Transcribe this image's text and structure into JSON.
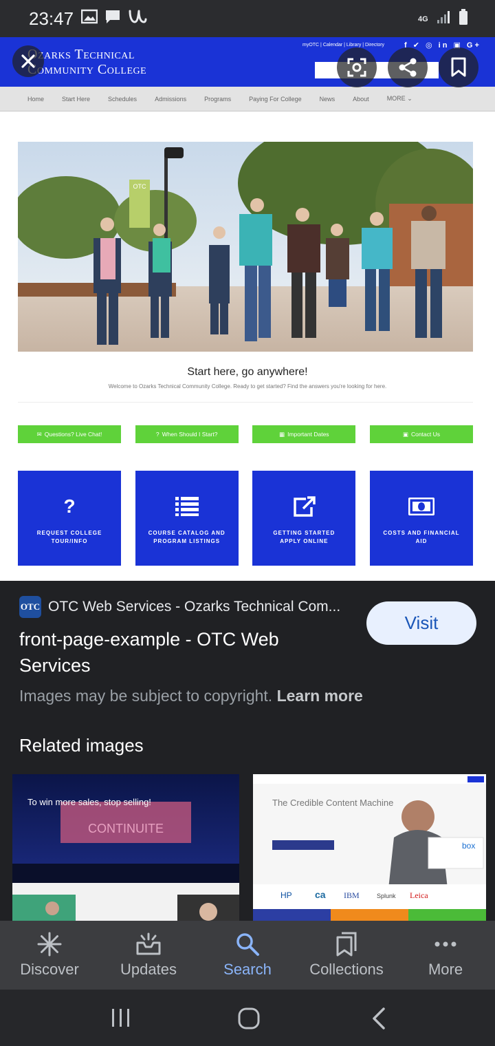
{
  "status_bar": {
    "time": "23:47",
    "network": "4G",
    "icons": [
      "image-icon",
      "chat-icon",
      "app-u-icon",
      "signal-icon",
      "battery-icon"
    ]
  },
  "preview": {
    "site": {
      "logo_line1": "Ozarks Technical",
      "logo_line2": "Community College",
      "top_links": "myOTC | Calendar | Library | Directory",
      "social": "f ✔ ◎ in ▣ G+",
      "nav": [
        "Home",
        "Start Here",
        "Schedules",
        "Admissions",
        "Programs",
        "Paying For College",
        "News",
        "About",
        "MORE ⌄"
      ],
      "banner_flag": "OTC",
      "caption": "Start here, go anywhere!",
      "subcaption": "Welcome to Ozarks Technical Community College. Ready to get started? Find the answers you're looking for here.",
      "green_buttons": [
        {
          "label": "Questions? Live Chat!",
          "icon": "chat-icon"
        },
        {
          "label": "When Should I Start?",
          "icon": "question-icon"
        },
        {
          "label": "Important Dates",
          "icon": "calendar-icon"
        },
        {
          "label": "Contact Us",
          "icon": "phone-icon"
        }
      ],
      "tiles": [
        {
          "label": "REQUEST COLLEGE TOUR/INFO",
          "icon": "question-icon"
        },
        {
          "label": "COURSE CATALOG AND PROGRAM LISTINGS",
          "icon": "list-icon"
        },
        {
          "label": "GETTING STARTED APPLY ONLINE",
          "icon": "external-link-icon"
        },
        {
          "label": "COSTS AND FINANCIAL AID",
          "icon": "money-icon"
        }
      ]
    },
    "overlay_buttons": [
      "close-icon",
      "lens-icon",
      "share-icon",
      "bookmark-icon"
    ]
  },
  "result": {
    "favicon_text": "OTC",
    "source": "OTC Web Services - Ozarks Technical Com...",
    "visit_label": "Visit",
    "title": "front-page-example - OTC Web Services",
    "copyright_text": "Images may be subject to copyright.",
    "learn_more": "Learn more"
  },
  "related": {
    "title": "Related images",
    "thumb1": {
      "headline": "To win more sales, stop selling!",
      "brand": "CONTINUITE"
    },
    "thumb2": {
      "headline": "The Credible Content Machine",
      "brand": "box",
      "logos": [
        "HP",
        "ca",
        "IBM",
        "Splunk",
        "Leica"
      ]
    }
  },
  "bottom_nav": {
    "items": [
      {
        "label": "Discover",
        "icon": "asterisk-icon"
      },
      {
        "label": "Updates",
        "icon": "updates-icon"
      },
      {
        "label": "Search",
        "icon": "search-icon"
      },
      {
        "label": "Collections",
        "icon": "collections-icon"
      },
      {
        "label": "More",
        "icon": "more-dots-icon"
      }
    ],
    "active": "Search"
  },
  "system_nav": [
    "recents-icon",
    "home-icon",
    "back-icon"
  ],
  "colors": {
    "site_blue": "#1a33d6",
    "site_green": "#5fd23a",
    "dark_bg": "#202124",
    "visit_bg": "#e8f0fe",
    "active_tab": "#8ab4f8"
  }
}
